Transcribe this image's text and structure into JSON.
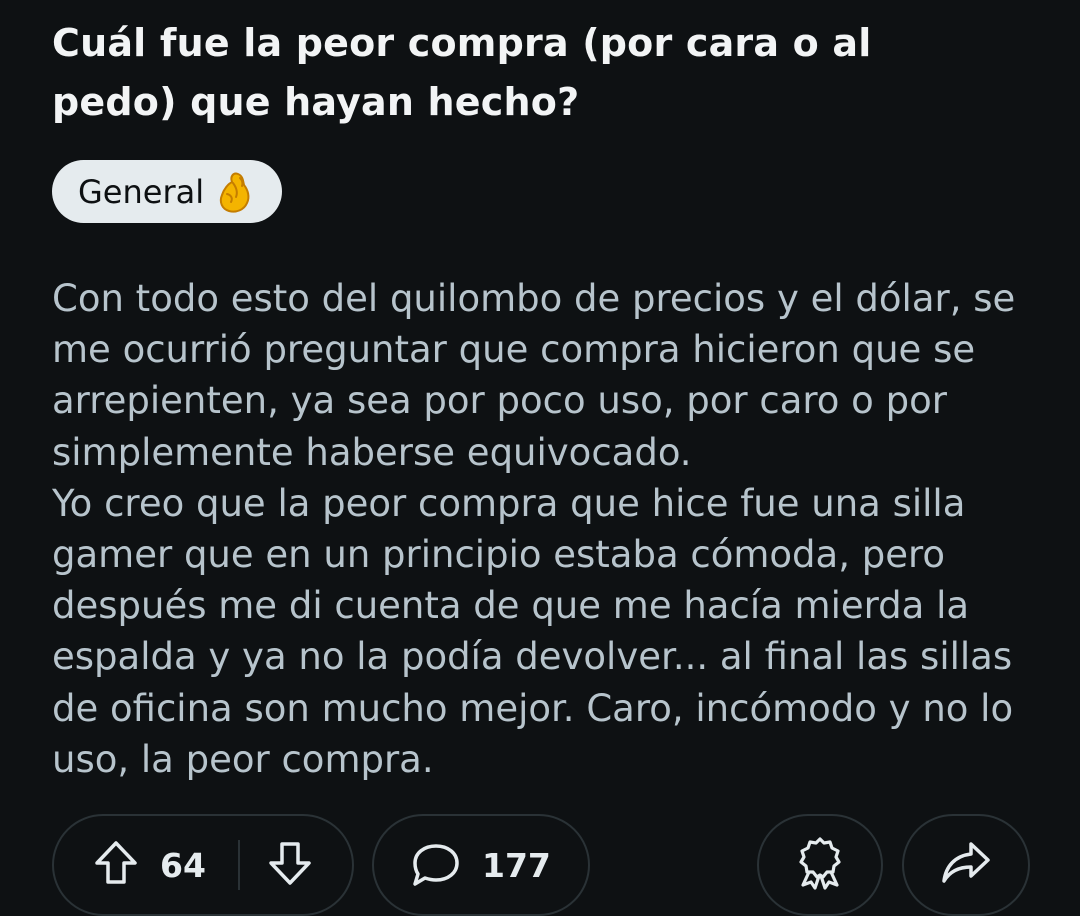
{
  "post": {
    "title": "Cuál fue la peor compra (por cara o al pedo) que hayan hecho?",
    "flair": {
      "label": "General",
      "emoji_icon": "pinched-fingers-icon"
    },
    "body": [
      "Con todo esto del quilombo de precios y el dólar, se me ocurrió preguntar que compra hicieron que se arrepienten, ya sea por poco uso, por caro o por simplemente haberse equivocado.",
      "Yo creo que la peor compra que hice fue una silla gamer que en un principio estaba cómoda, pero después me di cuenta de que me hacía mierda la espalda y ya no la podía devolver... al final las sillas de oficina son mucho mejor. Caro, incómodo y no lo uso, la peor compra."
    ]
  },
  "actions": {
    "upvote_icon": "arrow-up-icon",
    "vote_count": "64",
    "downvote_icon": "arrow-down-icon",
    "comment_icon": "speech-bubble-icon",
    "comment_count": "177",
    "award_icon": "award-ribbon-icon",
    "share_icon": "share-arrow-icon"
  },
  "colors": {
    "background": "#0e1113",
    "title_text": "#f2f4f5",
    "body_text": "#b7c4cc",
    "flair_background": "#e5ebee",
    "pill_border": "#2a3236"
  }
}
